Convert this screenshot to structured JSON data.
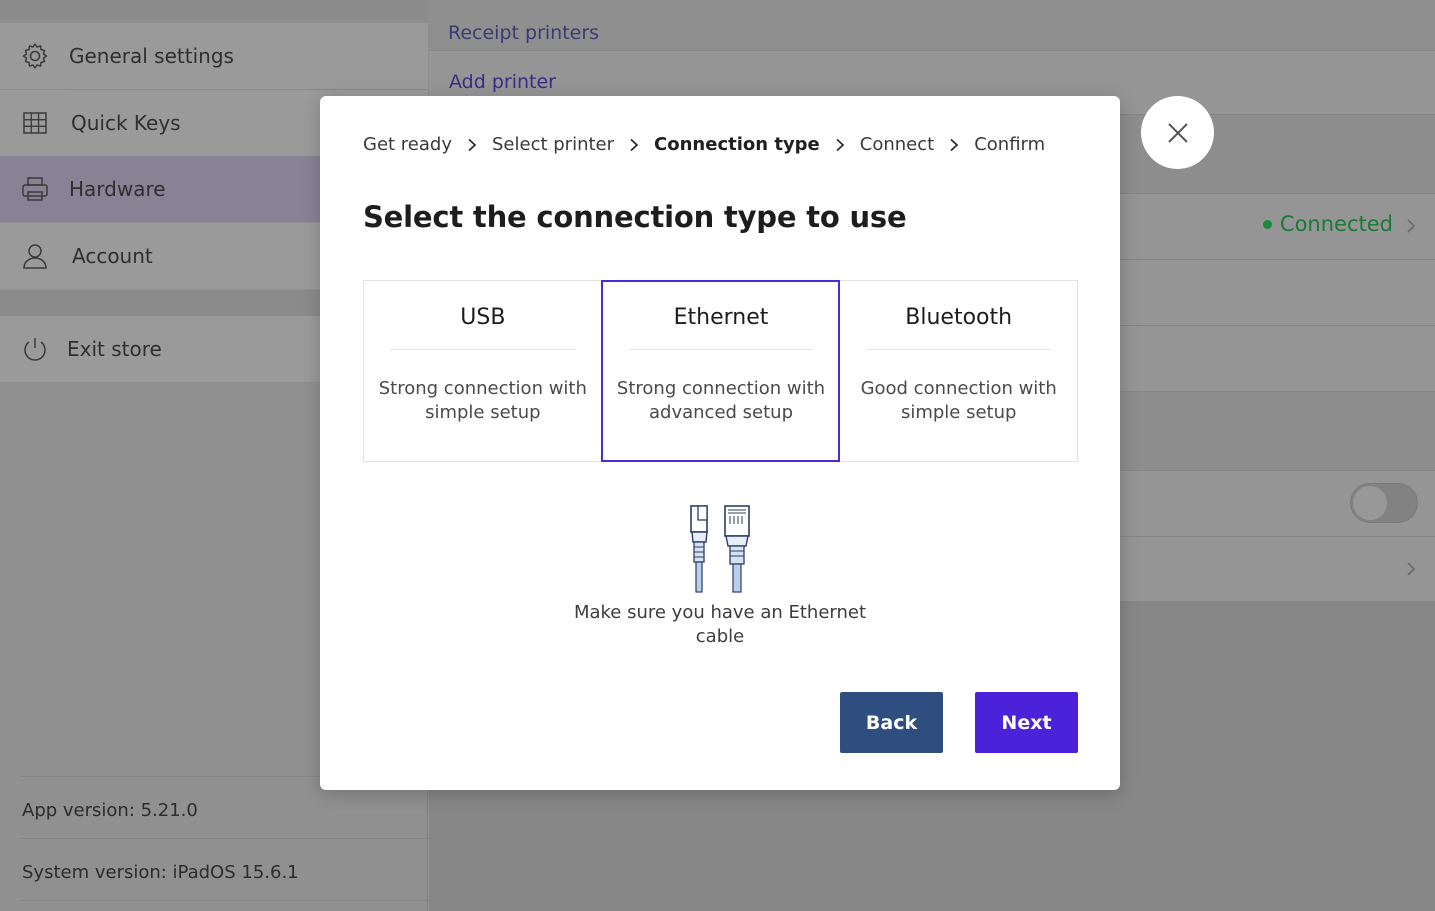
{
  "sidebar": {
    "items": [
      {
        "label": "General settings",
        "icon": "gear-icon"
      },
      {
        "label": "Quick Keys",
        "icon": "grid-icon"
      },
      {
        "label": "Hardware",
        "icon": "printer-icon",
        "active": true
      },
      {
        "label": "Account",
        "icon": "user-icon"
      },
      {
        "label": "Exit store",
        "icon": "power-icon"
      }
    ],
    "app_version": "App version: 5.21.0",
    "system_version": "System version: iPadOS 15.6.1"
  },
  "main": {
    "section_title": "Receipt printers",
    "add_printer": "Add printer",
    "status_connected": "Connected"
  },
  "modal": {
    "breadcrumbs": [
      {
        "label": "Get ready",
        "current": false
      },
      {
        "label": "Select printer",
        "current": false
      },
      {
        "label": "Connection type",
        "current": true
      },
      {
        "label": "Connect",
        "current": false
      },
      {
        "label": "Confirm",
        "current": false
      }
    ],
    "title": "Select the connection type to use",
    "options": [
      {
        "title": "USB",
        "desc": "Strong connection with simple setup",
        "selected": false
      },
      {
        "title": "Ethernet",
        "desc": "Strong connection with advanced setup",
        "selected": true
      },
      {
        "title": "Bluetooth",
        "desc": "Good connection with simple setup",
        "selected": false
      }
    ],
    "hint": "Make sure you have an Ethernet cable",
    "back_label": "Back",
    "next_label": "Next"
  },
  "colors": {
    "accent": "#4b22d9",
    "back_button": "#2e4e7f",
    "connected": "#1a7a36"
  }
}
